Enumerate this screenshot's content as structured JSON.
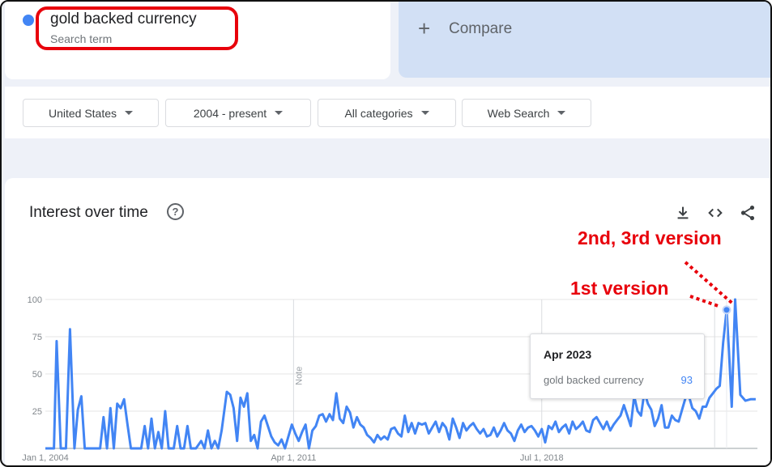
{
  "search_term": {
    "label": "gold backed currency",
    "sub_label": "Search term",
    "color": "#4285f4"
  },
  "compare": {
    "icon": "plus-icon",
    "label": "Compare"
  },
  "filters": [
    {
      "label": "United States"
    },
    {
      "label": "2004 - present"
    },
    {
      "label": "All categories"
    },
    {
      "label": "Web Search"
    }
  ],
  "chart": {
    "title": "Interest over time",
    "toolbar_icons": [
      "download-icon",
      "embed-code-icon",
      "share-icon"
    ],
    "notes": [
      "Note",
      "Note"
    ],
    "tooltip": {
      "date": "Apr 2023",
      "series": "gold backed currency",
      "value": "93"
    }
  },
  "annotations": {
    "first": "1st version",
    "second": "2nd, 3rd version",
    "highlight_color": "#e8000b"
  },
  "chart_data": {
    "type": "line",
    "title": "Interest over time",
    "yticks": [
      25,
      50,
      75,
      100
    ],
    "ylim": [
      0,
      100
    ],
    "xticks": [
      "Jan 1, 2004",
      "Apr 1, 2011",
      "Jul 1, 2018"
    ],
    "xlim": [
      2004.0,
      2024.8
    ],
    "grid": true,
    "series": [
      {
        "name": "gold backed currency",
        "color": "#4285f4",
        "points": [
          [
            2004.0,
            0
          ],
          [
            2004.25,
            0
          ],
          [
            2004.33,
            72
          ],
          [
            2004.45,
            0
          ],
          [
            2004.6,
            0
          ],
          [
            2004.72,
            80
          ],
          [
            2004.85,
            0
          ],
          [
            2004.95,
            26
          ],
          [
            2005.05,
            35
          ],
          [
            2005.15,
            0
          ],
          [
            2005.4,
            0
          ],
          [
            2005.6,
            0
          ],
          [
            2005.7,
            21
          ],
          [
            2005.8,
            0
          ],
          [
            2005.9,
            27
          ],
          [
            2006.0,
            0
          ],
          [
            2006.1,
            30
          ],
          [
            2006.2,
            27
          ],
          [
            2006.3,
            33
          ],
          [
            2006.4,
            16
          ],
          [
            2006.5,
            0
          ],
          [
            2006.8,
            0
          ],
          [
            2006.9,
            15
          ],
          [
            2007.0,
            0
          ],
          [
            2007.1,
            20
          ],
          [
            2007.2,
            0
          ],
          [
            2007.3,
            11
          ],
          [
            2007.4,
            0
          ],
          [
            2007.5,
            25
          ],
          [
            2007.6,
            0
          ],
          [
            2007.75,
            0
          ],
          [
            2007.85,
            15
          ],
          [
            2007.95,
            0
          ],
          [
            2008.05,
            0
          ],
          [
            2008.15,
            15
          ],
          [
            2008.25,
            0
          ],
          [
            2008.4,
            0
          ],
          [
            2008.55,
            5
          ],
          [
            2008.65,
            0
          ],
          [
            2008.75,
            12
          ],
          [
            2008.85,
            0
          ],
          [
            2008.95,
            5
          ],
          [
            2009.05,
            0
          ],
          [
            2009.15,
            12
          ],
          [
            2009.3,
            38
          ],
          [
            2009.4,
            36
          ],
          [
            2009.5,
            27
          ],
          [
            2009.6,
            5
          ],
          [
            2009.7,
            34
          ],
          [
            2009.8,
            28
          ],
          [
            2009.9,
            37
          ],
          [
            2010.0,
            5
          ],
          [
            2010.1,
            9
          ],
          [
            2010.2,
            0
          ],
          [
            2010.3,
            18
          ],
          [
            2010.4,
            22
          ],
          [
            2010.5,
            15
          ],
          [
            2010.6,
            8
          ],
          [
            2010.7,
            4
          ],
          [
            2010.8,
            2
          ],
          [
            2010.9,
            6
          ],
          [
            2011.0,
            0
          ],
          [
            2011.1,
            8
          ],
          [
            2011.2,
            16
          ],
          [
            2011.3,
            10
          ],
          [
            2011.4,
            5
          ],
          [
            2011.5,
            11
          ],
          [
            2011.6,
            16
          ],
          [
            2011.7,
            0
          ],
          [
            2011.8,
            12
          ],
          [
            2011.9,
            15
          ],
          [
            2012.0,
            22
          ],
          [
            2012.1,
            23
          ],
          [
            2012.2,
            18
          ],
          [
            2012.3,
            23
          ],
          [
            2012.4,
            19
          ],
          [
            2012.5,
            37
          ],
          [
            2012.6,
            20
          ],
          [
            2012.7,
            17
          ],
          [
            2012.8,
            28
          ],
          [
            2012.9,
            24
          ],
          [
            2013.0,
            14
          ],
          [
            2013.1,
            21
          ],
          [
            2013.2,
            16
          ],
          [
            2013.3,
            14
          ],
          [
            2013.4,
            9
          ],
          [
            2013.5,
            7
          ],
          [
            2013.6,
            4
          ],
          [
            2013.7,
            9
          ],
          [
            2013.8,
            6
          ],
          [
            2013.9,
            8
          ],
          [
            2014.0,
            6
          ],
          [
            2014.1,
            13
          ],
          [
            2014.2,
            14
          ],
          [
            2014.3,
            10
          ],
          [
            2014.4,
            8
          ],
          [
            2014.5,
            22
          ],
          [
            2014.6,
            11
          ],
          [
            2014.7,
            17
          ],
          [
            2014.8,
            10
          ],
          [
            2014.9,
            17
          ],
          [
            2015.0,
            16
          ],
          [
            2015.1,
            17
          ],
          [
            2015.2,
            10
          ],
          [
            2015.3,
            14
          ],
          [
            2015.4,
            18
          ],
          [
            2015.5,
            11
          ],
          [
            2015.6,
            17
          ],
          [
            2015.7,
            14
          ],
          [
            2015.8,
            6
          ],
          [
            2015.9,
            20
          ],
          [
            2016.0,
            14
          ],
          [
            2016.1,
            7
          ],
          [
            2016.2,
            17
          ],
          [
            2016.3,
            12
          ],
          [
            2016.4,
            15
          ],
          [
            2016.5,
            17
          ],
          [
            2016.6,
            13
          ],
          [
            2016.7,
            10
          ],
          [
            2016.8,
            13
          ],
          [
            2016.9,
            8
          ],
          [
            2017.0,
            9
          ],
          [
            2017.1,
            14
          ],
          [
            2017.2,
            8
          ],
          [
            2017.3,
            12
          ],
          [
            2017.4,
            17
          ],
          [
            2017.5,
            12
          ],
          [
            2017.6,
            10
          ],
          [
            2017.7,
            5
          ],
          [
            2017.8,
            12
          ],
          [
            2017.9,
            16
          ],
          [
            2018.0,
            11
          ],
          [
            2018.1,
            14
          ],
          [
            2018.2,
            15
          ],
          [
            2018.3,
            12
          ],
          [
            2018.4,
            8
          ],
          [
            2018.5,
            13
          ],
          [
            2018.6,
            4
          ],
          [
            2018.7,
            15
          ],
          [
            2018.8,
            13
          ],
          [
            2018.9,
            18
          ],
          [
            2019.0,
            11
          ],
          [
            2019.1,
            14
          ],
          [
            2019.2,
            16
          ],
          [
            2019.3,
            10
          ],
          [
            2019.4,
            18
          ],
          [
            2019.5,
            13
          ],
          [
            2019.6,
            15
          ],
          [
            2019.7,
            18
          ],
          [
            2019.8,
            12
          ],
          [
            2019.9,
            11
          ],
          [
            2020.0,
            19
          ],
          [
            2020.1,
            21
          ],
          [
            2020.2,
            17
          ],
          [
            2020.3,
            13
          ],
          [
            2020.4,
            18
          ],
          [
            2020.5,
            12
          ],
          [
            2020.6,
            16
          ],
          [
            2020.7,
            19
          ],
          [
            2020.8,
            22
          ],
          [
            2020.9,
            29
          ],
          [
            2021.0,
            22
          ],
          [
            2021.1,
            15
          ],
          [
            2021.2,
            35
          ],
          [
            2021.3,
            25
          ],
          [
            2021.4,
            22
          ],
          [
            2021.5,
            38
          ],
          [
            2021.6,
            30
          ],
          [
            2021.7,
            26
          ],
          [
            2021.8,
            15
          ],
          [
            2021.9,
            20
          ],
          [
            2022.0,
            29
          ],
          [
            2022.1,
            14
          ],
          [
            2022.2,
            14
          ],
          [
            2022.3,
            22
          ],
          [
            2022.4,
            19
          ],
          [
            2022.5,
            18
          ],
          [
            2022.6,
            26
          ],
          [
            2022.7,
            34
          ],
          [
            2022.8,
            35
          ],
          [
            2022.9,
            27
          ],
          [
            2023.0,
            25
          ],
          [
            2023.1,
            20
          ],
          [
            2023.2,
            28
          ],
          [
            2023.3,
            28
          ],
          [
            2023.4,
            34
          ],
          [
            2023.5,
            37
          ],
          [
            2023.6,
            40
          ],
          [
            2023.7,
            42
          ],
          [
            2023.8,
            71
          ],
          [
            2023.9,
            93
          ],
          [
            2023.97,
            65
          ],
          [
            2024.05,
            28
          ],
          [
            2024.15,
            100
          ],
          [
            2024.3,
            36
          ],
          [
            2024.45,
            32
          ],
          [
            2024.6,
            33
          ],
          [
            2024.75,
            33
          ]
        ]
      }
    ],
    "highlight_point": {
      "x": 2023.9,
      "y": 93
    }
  }
}
